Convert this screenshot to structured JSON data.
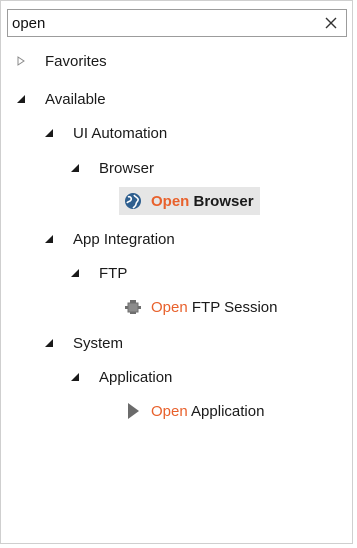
{
  "search": {
    "value": "open",
    "clear_icon": "close-icon"
  },
  "tree": {
    "favorites": {
      "label": "Favorites",
      "expanded": false
    },
    "available": {
      "label": "Available",
      "expanded": true
    },
    "ui_automation": {
      "label": "UI Automation"
    },
    "browser_group": {
      "label": "Browser"
    },
    "open_browser": {
      "match": "Open",
      "rest": " Browser",
      "icon": "globe-icon",
      "selected": true
    },
    "app_integration": {
      "label": "App Integration"
    },
    "ftp_group": {
      "label": "FTP"
    },
    "open_ftp": {
      "match": "Open",
      "rest": " FTP Session",
      "icon": "ftp-session-icon"
    },
    "system": {
      "label": "System"
    },
    "application_group": {
      "label": "Application"
    },
    "open_application": {
      "match": "Open",
      "rest": " Application",
      "icon": "play-icon"
    }
  },
  "colors": {
    "match_highlight": "#e8612c",
    "selected_bg": "#e6e6e6",
    "border": "#9c9c9c"
  }
}
